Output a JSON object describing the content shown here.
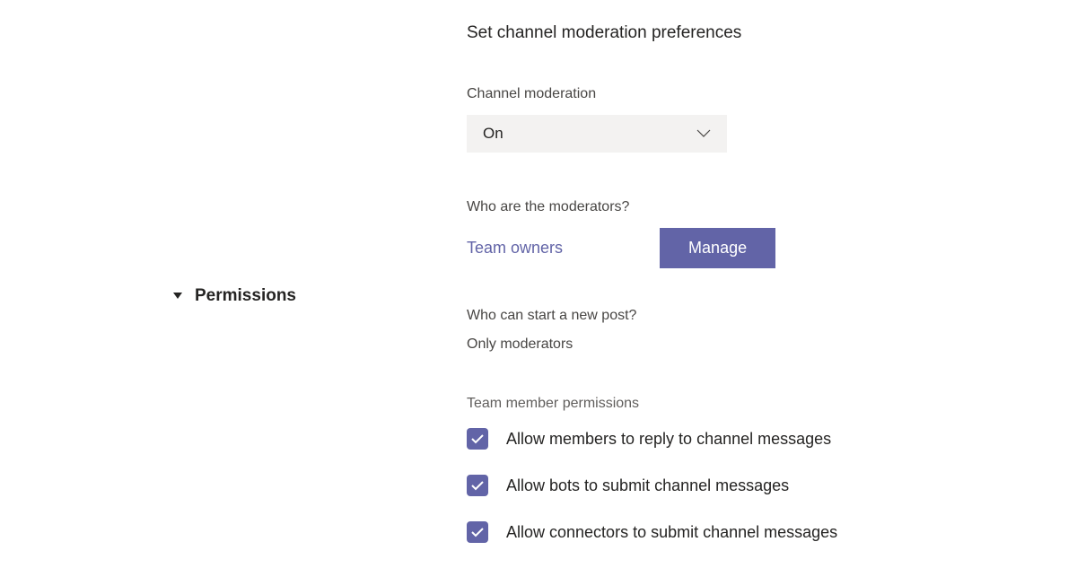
{
  "section": {
    "title": "Permissions",
    "heading": "Set channel moderation preferences"
  },
  "moderation": {
    "label": "Channel moderation",
    "value": "On"
  },
  "moderators": {
    "label": "Who are the moderators?",
    "value": "Team owners",
    "manage_label": "Manage"
  },
  "post": {
    "label": "Who can start a new post?",
    "value": "Only moderators"
  },
  "memberPermissions": {
    "label": "Team member permissions",
    "items": [
      "Allow members to reply to channel messages",
      "Allow bots to submit channel messages",
      "Allow connectors to submit channel messages"
    ]
  }
}
